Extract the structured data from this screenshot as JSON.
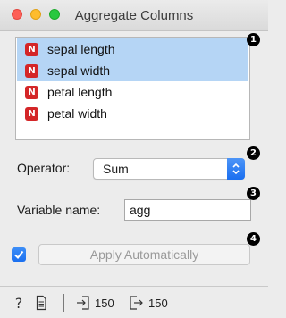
{
  "window": {
    "title": "Aggregate Columns",
    "controls": [
      "close",
      "minimize",
      "maximize"
    ]
  },
  "markers": [
    "1",
    "2",
    "3",
    "4"
  ],
  "variables": [
    {
      "label": "sepal length",
      "type": "N",
      "selected": true
    },
    {
      "label": "sepal width",
      "type": "N",
      "selected": true
    },
    {
      "label": "petal length",
      "type": "N",
      "selected": false
    },
    {
      "label": "petal width",
      "type": "N",
      "selected": false
    }
  ],
  "operator": {
    "label": "Operator:",
    "value": "Sum"
  },
  "variable_name": {
    "label": "Variable name:",
    "value": "agg"
  },
  "apply": {
    "checked": true,
    "label": "Apply Automatically"
  },
  "status": {
    "input_count": "150",
    "output_count": "150"
  },
  "colors": {
    "accent": "#1a6ff0",
    "selection": "#b5d5f5",
    "numeric_badge": "#d42628"
  }
}
